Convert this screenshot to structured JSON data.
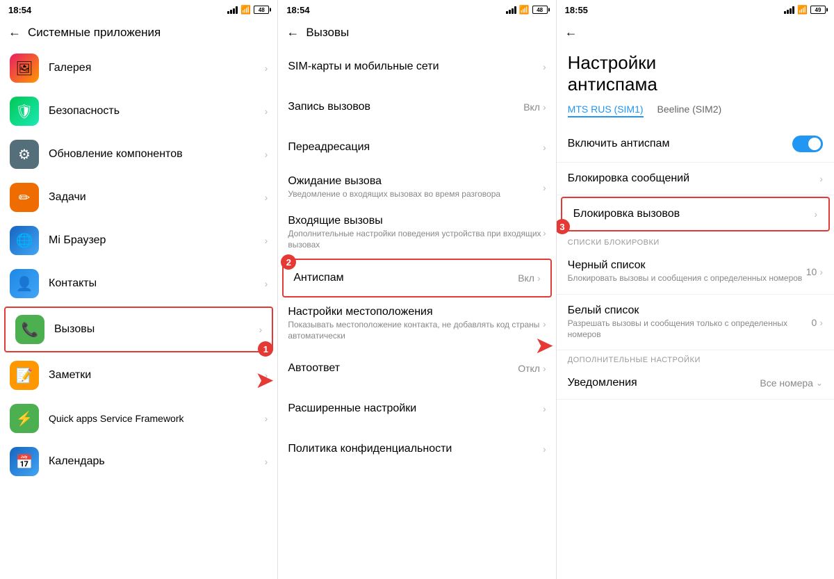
{
  "panels": [
    {
      "id": "panel1",
      "statusBar": {
        "time": "18:54",
        "dots": "··",
        "battery": "48"
      },
      "header": {
        "title": "Системные приложения",
        "backLabel": "←"
      },
      "items": [
        {
          "id": "gallery",
          "iconType": "gallery",
          "iconChar": "🖼",
          "label": "Галерея",
          "subtitle": ""
        },
        {
          "id": "security",
          "iconType": "security",
          "iconChar": "🛡",
          "label": "Безопасность",
          "subtitle": ""
        },
        {
          "id": "update",
          "iconType": "update",
          "iconChar": "⚙",
          "label": "Обновление компонентов",
          "subtitle": ""
        },
        {
          "id": "tasks",
          "iconType": "tasks",
          "iconChar": "✏",
          "label": "Задачи",
          "subtitle": ""
        },
        {
          "id": "browser",
          "iconType": "browser",
          "iconChar": "🌐",
          "label": "Mi Браузер",
          "subtitle": ""
        },
        {
          "id": "contacts",
          "iconType": "contacts",
          "iconChar": "👤",
          "label": "Контакты",
          "subtitle": ""
        },
        {
          "id": "calls",
          "iconType": "calls",
          "iconChar": "📞",
          "label": "Вызовы",
          "subtitle": "",
          "highlighted": true
        },
        {
          "id": "notes",
          "iconType": "notes",
          "iconChar": "📝",
          "label": "Заметки",
          "subtitle": ""
        },
        {
          "id": "qapps",
          "iconType": "qapps",
          "iconChar": "⚡",
          "label": "Quick apps Service Framework",
          "subtitle": ""
        },
        {
          "id": "calendar",
          "iconType": "calendar",
          "iconChar": "📅",
          "label": "Календарь",
          "subtitle": ""
        }
      ]
    },
    {
      "id": "panel2",
      "statusBar": {
        "time": "18:54",
        "dots": "··",
        "battery": "48"
      },
      "header": {
        "title": "Вызовы",
        "backLabel": "←"
      },
      "items": [
        {
          "id": "sim",
          "label": "SIM-карты и мобильные сети",
          "subtitle": "",
          "value": ""
        },
        {
          "id": "record",
          "label": "Запись вызовов",
          "subtitle": "",
          "value": "Вкл"
        },
        {
          "id": "forward",
          "label": "Переадресация",
          "subtitle": "",
          "value": ""
        },
        {
          "id": "waiting",
          "label": "Ожидание вызова",
          "subtitle": "Уведомление о входящих вызовах во время разговора",
          "value": ""
        },
        {
          "id": "incoming",
          "label": "Входящие вызовы",
          "subtitle": "Дополнительные настройки поведения устройства при входящих вызовах",
          "value": ""
        },
        {
          "id": "antispam",
          "label": "Антиспам",
          "subtitle": "",
          "value": "Вкл",
          "highlighted": true
        },
        {
          "id": "location",
          "label": "Настройки местоположения",
          "subtitle": "Показывать местоположение контакта, не добавлять код страны автоматически",
          "value": ""
        },
        {
          "id": "autoreply",
          "label": "Автоответ",
          "subtitle": "",
          "value": "Откл"
        },
        {
          "id": "advanced",
          "label": "Расширенные настройки",
          "subtitle": "",
          "value": ""
        },
        {
          "id": "policy",
          "label": "Политика конфиденциальности",
          "subtitle": "",
          "value": ""
        }
      ]
    },
    {
      "id": "panel3",
      "statusBar": {
        "time": "18:55",
        "dots": "··",
        "battery": "49"
      },
      "header": {
        "backLabel": "←"
      },
      "pageTitle": "Настройки\nантиспама",
      "simTabs": [
        {
          "id": "sim1",
          "label": "MTS RUS (SIM1)",
          "active": true
        },
        {
          "id": "sim2",
          "label": "Beeline (SIM2)",
          "active": false
        }
      ],
      "toggleRow": {
        "label": "Включить антиспам",
        "enabled": true
      },
      "settings": [
        {
          "id": "block-messages",
          "title": "Блокировка сообщений",
          "subtitle": "",
          "value": "",
          "highlighted": false
        },
        {
          "id": "block-calls",
          "title": "Блокировка вызовов",
          "subtitle": "",
          "value": "",
          "highlighted": true
        }
      ],
      "blocklistSection": "СПИСКИ БЛОКИРОВКИ",
      "blocklists": [
        {
          "id": "blacklist",
          "title": "Черный список",
          "subtitle": "Блокировать вызовы и сообщения с определенных номеров",
          "value": "10"
        },
        {
          "id": "whitelist",
          "title": "Белый список",
          "subtitle": "Разрешать вызовы и сообщения только с определенных номеров",
          "value": "0"
        }
      ],
      "additionalSection": "ДОПОЛНИТЕЛЬНЫЕ НАСТРОЙКИ",
      "additionalSettings": [
        {
          "id": "notifications",
          "title": "Уведомления",
          "subtitle": "",
          "value": "Все номера"
        }
      ]
    }
  ],
  "annotations": {
    "badge1": "1",
    "badge2": "2",
    "badge3": "3"
  }
}
